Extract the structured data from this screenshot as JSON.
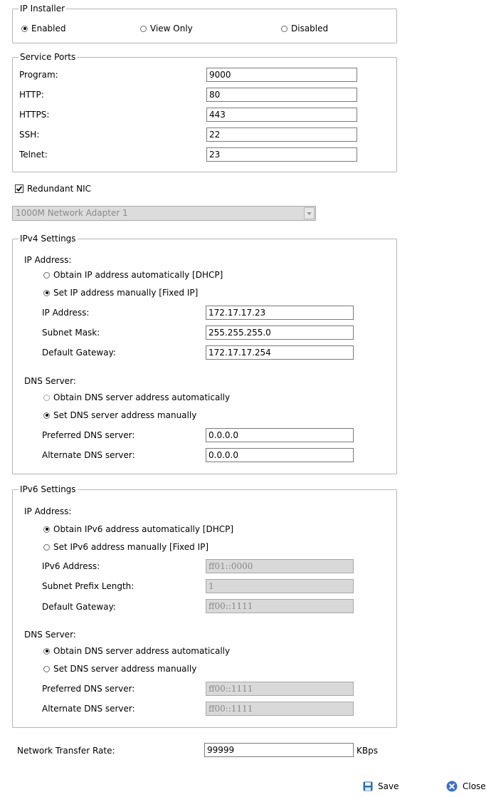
{
  "ip_installer": {
    "legend": "IP Installer",
    "options": [
      "Enabled",
      "View Only",
      "Disabled"
    ],
    "selected": "Enabled"
  },
  "service_ports": {
    "legend": "Service Ports",
    "program": {
      "label": "Program:",
      "value": "9000"
    },
    "http": {
      "label": "HTTP:",
      "value": "80"
    },
    "https": {
      "label": "HTTPS:",
      "value": "443"
    },
    "ssh": {
      "label": "SSH:",
      "value": "22"
    },
    "telnet": {
      "label": "Telnet:",
      "value": "23"
    }
  },
  "redundant_nic": {
    "label": "Redundant NIC",
    "checked": true
  },
  "network_adapter": {
    "value": "1000M Network Adapter 1",
    "disabled": true
  },
  "ipv4": {
    "legend": "IPv4 Settings",
    "ip_heading": "IP Address:",
    "ip_auto": "Obtain IP address automatically [DHCP]",
    "ip_manual": "Set IP address manually [Fixed IP]",
    "ip_mode": "manual",
    "ip_address": {
      "label": "IP Address:",
      "value": "172.17.17.23"
    },
    "subnet_mask": {
      "label": "Subnet Mask:",
      "value": "255.255.255.0"
    },
    "gateway": {
      "label": "Default Gateway:",
      "value": "172.17.17.254"
    },
    "dns_heading": "DNS Server:",
    "dns_auto": "Obtain DNS server address automatically",
    "dns_manual": "Set DNS server address manually",
    "dns_mode": "manual",
    "preferred_dns": {
      "label": "Preferred DNS server:",
      "value": "0.0.0.0"
    },
    "alternate_dns": {
      "label": "Alternate DNS server:",
      "value": "0.0.0.0"
    }
  },
  "ipv6": {
    "legend": "IPv6 Settings",
    "ip_heading": "IP Address:",
    "ip_auto": "Obtain IPv6 address automatically [DHCP]",
    "ip_manual": "Set IPv6 address manually [Fixed IP]",
    "ip_mode": "auto",
    "ip_address": {
      "label": "IPv6 Address:",
      "value": "ff01::0000"
    },
    "prefix_length": {
      "label": "Subnet Prefix Length:",
      "value": "1"
    },
    "gateway": {
      "label": "Default Gateway:",
      "value": "ff00::1111"
    },
    "dns_heading": "DNS Server:",
    "dns_auto": "Obtain DNS server address automatically",
    "dns_manual": "Set DNS server address manually",
    "dns_mode": "auto",
    "preferred_dns": {
      "label": "Preferred DNS server:",
      "value": "ff00::1111"
    },
    "alternate_dns": {
      "label": "Alternate DNS server:",
      "value": "ff00::1111"
    }
  },
  "transfer_rate": {
    "label": "Network Transfer Rate:",
    "value": "99999",
    "unit": "KBps"
  },
  "buttons": {
    "save": "Save",
    "close": "Close"
  },
  "colors": {
    "save_icon": "#2a6ebb",
    "close_icon": "#3a6fd0"
  },
  "icons": {
    "save": "floppy-disk-icon",
    "close": "close-circle-icon"
  }
}
